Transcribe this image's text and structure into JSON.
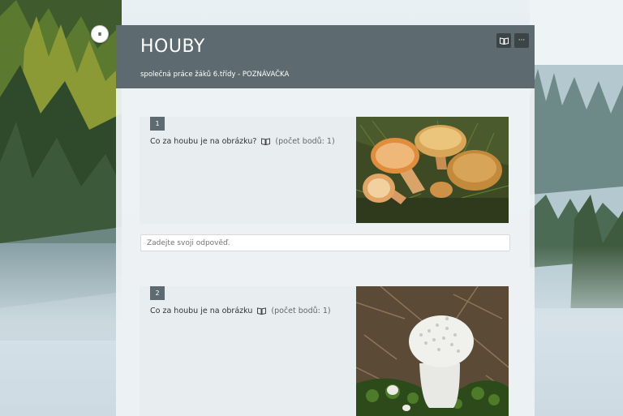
{
  "form": {
    "title": "HOUBY",
    "subtitle": "společná práce žáků 6.třídy - POZNÁVAČKA"
  },
  "toolbar": {
    "immersive_reader_icon": "immersive-reader-icon",
    "more_options_label": "···"
  },
  "immersive_button_label": "⏸︎",
  "questions": [
    {
      "number": "1",
      "text": "Co za houbu je na obrázku?",
      "points": "(počet bodů: 1)",
      "image": "mushroom-photo-orange",
      "answer_placeholder": "Zadejte svoji odpověď."
    },
    {
      "number": "2",
      "text": "Co za houbu je na obrázku",
      "points": "(počet bodů: 1)",
      "image": "mushroom-photo-puffball"
    }
  ],
  "colors": {
    "header": "#5d6a6f",
    "card": "#eef2f4",
    "question_bg": "#e7edf0",
    "badge": "#5d6a6f"
  }
}
